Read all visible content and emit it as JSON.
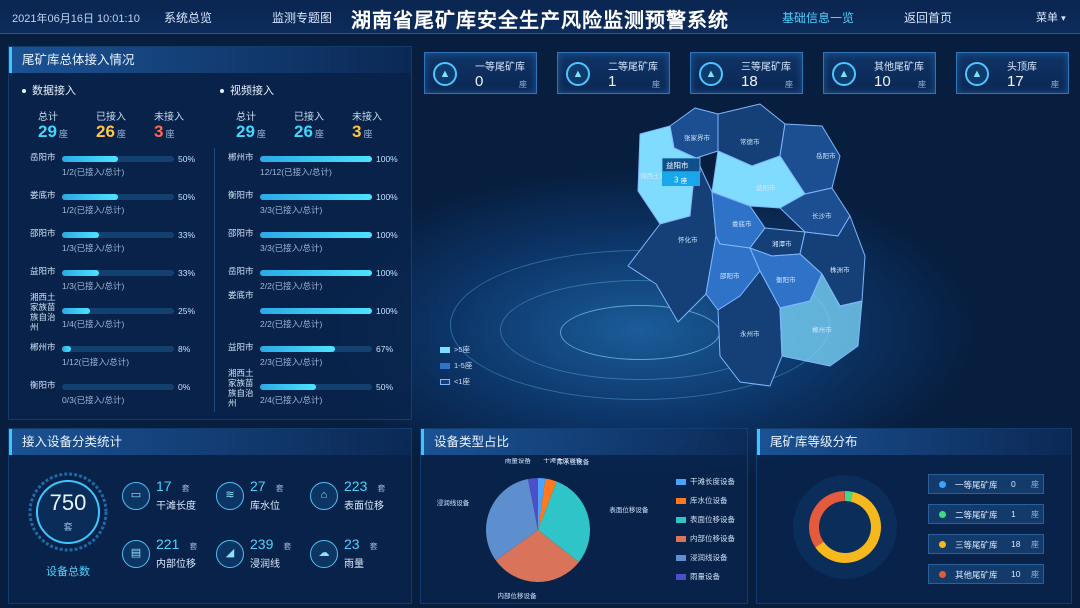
{
  "header": {
    "datetime": "2021年06月16日 10:01:10",
    "title": "湖南省尾矿库安全生产风险监测预警系统",
    "nav": [
      "系统总览",
      "监测专题图",
      "基础信息一览",
      "返回首页"
    ],
    "menu_label": "菜单",
    "menu_caret": "▾"
  },
  "access": {
    "title": "尾矿库总体接入情况",
    "data": {
      "title": "数据接入",
      "labels": [
        "总计",
        "已接入",
        "未接入"
      ],
      "total": "29",
      "connected": "26",
      "pending": "3",
      "unit": "座",
      "rows": [
        {
          "name": "岳阳市",
          "pct": "50%",
          "value": 0.5,
          "note": "1/2(已接入/总计)"
        },
        {
          "name": "娄底市",
          "pct": "50%",
          "value": 0.5,
          "note": "1/2(已接入/总计)"
        },
        {
          "name": "邵阳市",
          "pct": "33%",
          "value": 0.33,
          "note": "1/3(已接入/总计)"
        },
        {
          "name": "益阳市",
          "pct": "33%",
          "value": 0.33,
          "note": "1/3(已接入/总计)"
        },
        {
          "name": "湘西土家族苗族自治州",
          "pct": "25%",
          "value": 0.25,
          "note": "1/4(已接入/总计)"
        },
        {
          "name": "郴州市",
          "pct": "8%",
          "value": 0.08,
          "note": "1/12(已接入/总计)"
        },
        {
          "name": "衡阳市",
          "pct": "0%",
          "value": 0,
          "note": "0/3(已接入/总计)"
        }
      ]
    },
    "video": {
      "title": "视频接入",
      "labels": [
        "总计",
        "已接入",
        "未接入"
      ],
      "total": "29",
      "connected": "26",
      "pending": "3",
      "unit": "座",
      "rows": [
        {
          "name": "郴州市",
          "pct": "100%",
          "value": 1,
          "note": "12/12(已接入/总计)"
        },
        {
          "name": "衡阳市",
          "pct": "100%",
          "value": 1,
          "note": "3/3(已接入/总计)"
        },
        {
          "name": "邵阳市",
          "pct": "100%",
          "value": 1,
          "note": "3/3(已接入/总计)"
        },
        {
          "name": "岳阳市",
          "pct": "100%",
          "value": 1,
          "note": "2/2(已接入/总计)"
        },
        {
          "name": "娄底市",
          "pct": "100%",
          "value": 1,
          "note": "2/2(已接入/总计)"
        },
        {
          "name": "益阳市",
          "pct": "67%",
          "value": 0.67,
          "note": "2/3(已接入/总计)"
        },
        {
          "name": "湘西土家族苗族自治州",
          "pct": "50%",
          "value": 0.5,
          "note": "2/4(已接入/总计)"
        }
      ]
    }
  },
  "stats": [
    {
      "name": "一等尾矿库",
      "value": "0",
      "unit": "座"
    },
    {
      "name": "二等尾矿库",
      "value": "1",
      "unit": "座"
    },
    {
      "name": "三等尾矿库",
      "value": "18",
      "unit": "座"
    },
    {
      "name": "其他尾矿库",
      "value": "10",
      "unit": "座"
    },
    {
      "name": "头顶库",
      "value": "17",
      "unit": "座"
    }
  ],
  "map": {
    "cities": [
      "张家界市",
      "常德市",
      "岳阳市",
      "湘西土家族",
      "益阳市",
      "长沙市",
      "怀化市",
      "娄底市",
      "湘潭市",
      "株洲市",
      "邵阳市",
      "衡阳市",
      "永州市",
      "郴州市"
    ],
    "tooltip": {
      "city": "益阳市",
      "value": "3",
      "unit": "座"
    },
    "legend": [
      ">5座",
      "1-5座",
      "<1座"
    ],
    "colors": {
      "high": "#7fdcff",
      "mid": "#2f73c8",
      "low": "#143f77"
    }
  },
  "devices": {
    "title": "接入设备分类统计",
    "total": "750",
    "total_unit": "套",
    "total_label": "设备总数",
    "items": [
      {
        "icon": "dry-beach-icon",
        "value": "17",
        "unit": "套",
        "name": "干滩长度"
      },
      {
        "icon": "water-level-icon",
        "value": "27",
        "unit": "套",
        "name": "库水位"
      },
      {
        "icon": "surface-displacement-icon",
        "value": "223",
        "unit": "套",
        "name": "表面位移"
      },
      {
        "icon": "internal-displacement-icon",
        "value": "221",
        "unit": "套",
        "name": "内部位移"
      },
      {
        "icon": "phreatic-line-icon",
        "value": "239",
        "unit": "套",
        "name": "浸润线"
      },
      {
        "icon": "rainfall-icon",
        "value": "23",
        "unit": "套",
        "name": "雨量"
      }
    ]
  },
  "chart_data": [
    {
      "type": "pie",
      "title": "设备类型占比",
      "categories": [
        "干滩长度设备",
        "库水位设备",
        "表面位移设备",
        "内部位移设备",
        "浸润线设备",
        "雨量设备"
      ],
      "values": [
        17,
        27,
        223,
        221,
        239,
        23
      ],
      "colors": [
        "#4aa3ff",
        "#ff7a1f",
        "#2ec4c8",
        "#d9745a",
        "#5d8fcf",
        "#4b4fc9"
      ],
      "legend": "right"
    },
    {
      "type": "pie",
      "title": "尾矿库等级分布",
      "categories": [
        "一等尾矿库",
        "二等尾矿库",
        "三等尾矿库",
        "其他尾矿库"
      ],
      "values": [
        0,
        1,
        18,
        10
      ],
      "colors": [
        "#3aa3ff",
        "#3fd98a",
        "#f6b81c",
        "#e45a3c"
      ],
      "units": [
        "座",
        "座",
        "座",
        "座"
      ],
      "legend": "right"
    }
  ]
}
